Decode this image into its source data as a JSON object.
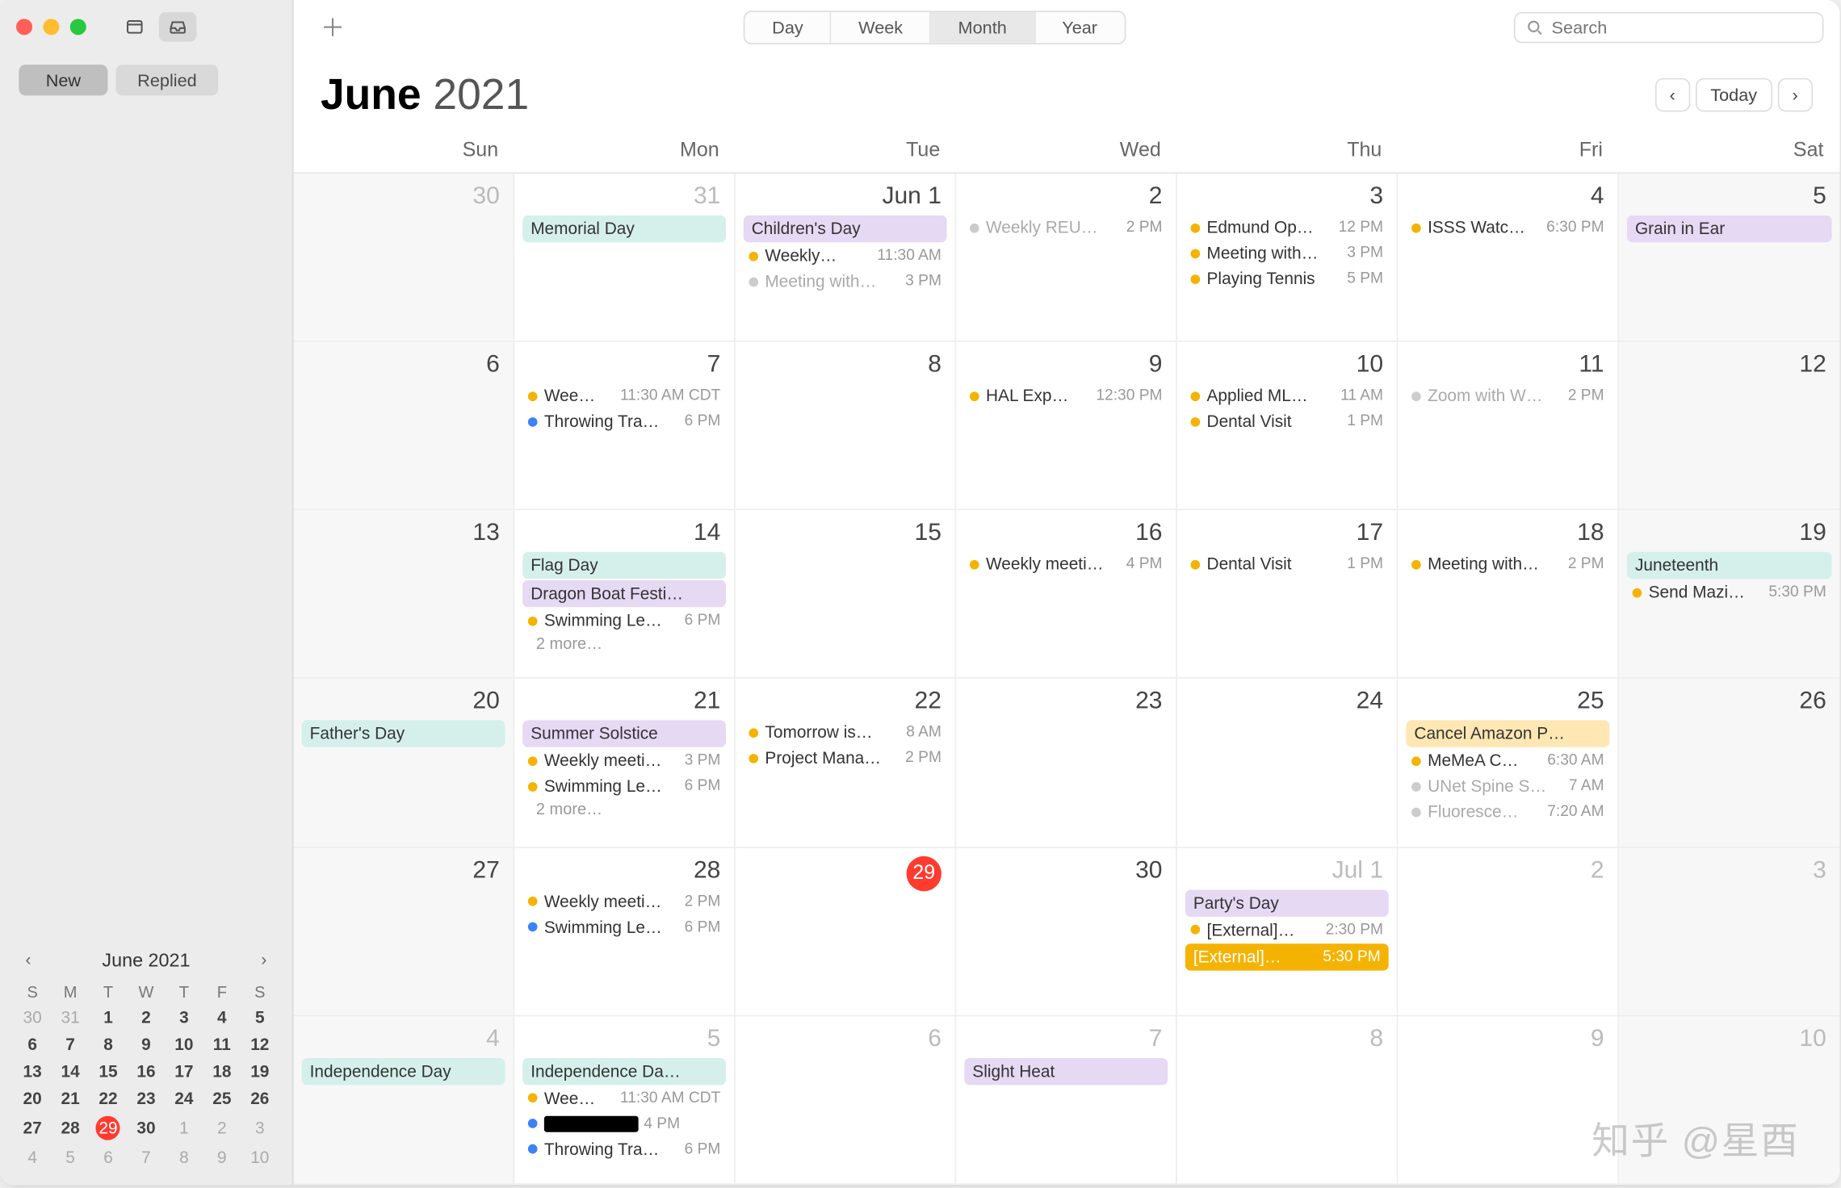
{
  "sidebar": {
    "filters": {
      "new": "New",
      "replied": "Replied"
    },
    "minical": {
      "title": "June 2021",
      "dow": [
        "S",
        "M",
        "T",
        "W",
        "T",
        "F",
        "S"
      ],
      "rows": [
        [
          {
            "n": "30",
            "dim": true
          },
          {
            "n": "31",
            "dim": true
          },
          {
            "n": "1",
            "bold": true
          },
          {
            "n": "2",
            "bold": true
          },
          {
            "n": "3",
            "bold": true
          },
          {
            "n": "4",
            "bold": true
          },
          {
            "n": "5",
            "bold": true
          }
        ],
        [
          {
            "n": "6",
            "bold": true
          },
          {
            "n": "7",
            "bold": true
          },
          {
            "n": "8",
            "bold": true
          },
          {
            "n": "9",
            "bold": true
          },
          {
            "n": "10",
            "bold": true
          },
          {
            "n": "11",
            "bold": true
          },
          {
            "n": "12",
            "bold": true
          }
        ],
        [
          {
            "n": "13",
            "bold": true
          },
          {
            "n": "14",
            "bold": true
          },
          {
            "n": "15",
            "bold": true
          },
          {
            "n": "16",
            "bold": true
          },
          {
            "n": "17",
            "bold": true
          },
          {
            "n": "18",
            "bold": true
          },
          {
            "n": "19",
            "bold": true
          }
        ],
        [
          {
            "n": "20",
            "bold": true
          },
          {
            "n": "21",
            "bold": true
          },
          {
            "n": "22",
            "bold": true
          },
          {
            "n": "23",
            "bold": true
          },
          {
            "n": "24",
            "bold": true
          },
          {
            "n": "25",
            "bold": true
          },
          {
            "n": "26",
            "bold": true
          }
        ],
        [
          {
            "n": "27",
            "bold": true
          },
          {
            "n": "28",
            "bold": true
          },
          {
            "n": "29",
            "today": true
          },
          {
            "n": "30",
            "bold": true
          },
          {
            "n": "1",
            "dim": true
          },
          {
            "n": "2",
            "dim": true
          },
          {
            "n": "3",
            "dim": true
          }
        ],
        [
          {
            "n": "4",
            "dim": true
          },
          {
            "n": "5",
            "dim": true
          },
          {
            "n": "6",
            "dim": true
          },
          {
            "n": "7",
            "dim": true
          },
          {
            "n": "8",
            "dim": true
          },
          {
            "n": "9",
            "dim": true
          },
          {
            "n": "10",
            "dim": true
          }
        ]
      ]
    }
  },
  "toolbar": {
    "views": [
      "Day",
      "Week",
      "Month",
      "Year"
    ],
    "active_view": "Month",
    "search_placeholder": "Search"
  },
  "header": {
    "month": "June",
    "year": "2021",
    "today": "Today"
  },
  "dow": [
    "Sun",
    "Mon",
    "Tue",
    "Wed",
    "Thu",
    "Fri",
    "Sat"
  ],
  "cells": [
    {
      "num": "30",
      "out": true,
      "wknd": true,
      "events": []
    },
    {
      "num": "31",
      "out": true,
      "events": [
        {
          "allday": true,
          "color": "teal",
          "title": "Memorial Day"
        }
      ]
    },
    {
      "num": "Jun 1",
      "events": [
        {
          "allday": true,
          "color": "violet",
          "title": "Children's Day"
        },
        {
          "dot": "yel",
          "title": "Weekly…",
          "time": "11:30 AM"
        },
        {
          "dot": "gray",
          "dim": true,
          "title": "Meeting with…",
          "time": "3 PM"
        }
      ]
    },
    {
      "num": "2",
      "events": [
        {
          "dot": "gray",
          "dim": true,
          "title": "Weekly REU…",
          "time": "2 PM"
        }
      ]
    },
    {
      "num": "3",
      "events": [
        {
          "dot": "yel",
          "title": "Edmund Op…",
          "time": "12 PM"
        },
        {
          "dot": "yel",
          "title": "Meeting with…",
          "time": "3 PM"
        },
        {
          "dot": "yel",
          "title": "Playing Tennis",
          "time": "5 PM"
        }
      ]
    },
    {
      "num": "4",
      "events": [
        {
          "dot": "yel",
          "title": "ISSS Watc…",
          "time": "6:30 PM"
        }
      ]
    },
    {
      "num": "5",
      "wknd": true,
      "events": [
        {
          "allday": true,
          "color": "violet",
          "title": "Grain in Ear"
        }
      ]
    },
    {
      "num": "6",
      "wknd": true,
      "events": []
    },
    {
      "num": "7",
      "events": [
        {
          "dot": "yel",
          "title": "Wee…",
          "time": "11:30 AM CDT"
        },
        {
          "dot": "blue",
          "title": "Throwing Tra…",
          "time": "6 PM"
        }
      ]
    },
    {
      "num": "8",
      "events": []
    },
    {
      "num": "9",
      "events": [
        {
          "dot": "yel",
          "title": "HAL Exp…",
          "time": "12:30 PM"
        }
      ]
    },
    {
      "num": "10",
      "events": [
        {
          "dot": "yel",
          "title": "Applied ML…",
          "time": "11 AM"
        },
        {
          "dot": "yel",
          "title": "Dental Visit",
          "time": "1 PM"
        }
      ]
    },
    {
      "num": "11",
      "events": [
        {
          "dot": "gray",
          "dim": true,
          "title": "Zoom with W…",
          "time": "2 PM"
        }
      ]
    },
    {
      "num": "12",
      "wknd": true,
      "events": []
    },
    {
      "num": "13",
      "wknd": true,
      "events": []
    },
    {
      "num": "14",
      "events": [
        {
          "allday": true,
          "color": "teal",
          "title": "Flag Day"
        },
        {
          "allday": true,
          "color": "violet",
          "title": "Dragon Boat Festi…"
        },
        {
          "dot": "yel",
          "title": "Swimming Le…",
          "time": "6 PM"
        }
      ],
      "more": "2 more…"
    },
    {
      "num": "15",
      "events": []
    },
    {
      "num": "16",
      "events": [
        {
          "dot": "yel",
          "title": "Weekly meeti…",
          "time": "4 PM"
        }
      ]
    },
    {
      "num": "17",
      "events": [
        {
          "dot": "yel",
          "title": "Dental Visit",
          "time": "1 PM"
        }
      ]
    },
    {
      "num": "18",
      "events": [
        {
          "dot": "yel",
          "title": "Meeting with…",
          "time": "2 PM"
        }
      ]
    },
    {
      "num": "19",
      "wknd": true,
      "events": [
        {
          "allday": true,
          "color": "teal",
          "title": "Juneteenth"
        },
        {
          "dot": "yel",
          "title": "Send Mazi…",
          "time": "5:30 PM"
        }
      ]
    },
    {
      "num": "20",
      "wknd": true,
      "events": [
        {
          "allday": true,
          "color": "teal",
          "title": "Father's Day"
        }
      ]
    },
    {
      "num": "21",
      "events": [
        {
          "allday": true,
          "color": "violet",
          "title": "Summer Solstice"
        },
        {
          "dot": "yel",
          "title": "Weekly meeti…",
          "time": "3 PM"
        },
        {
          "dot": "yel",
          "title": "Swimming Le…",
          "time": "6 PM"
        }
      ],
      "more": "2 more…"
    },
    {
      "num": "22",
      "events": [
        {
          "dot": "yel",
          "title": "Tomorrow is…",
          "time": "8 AM"
        },
        {
          "dot": "yel",
          "title": "Project Mana…",
          "time": "2 PM"
        }
      ]
    },
    {
      "num": "23",
      "events": []
    },
    {
      "num": "24",
      "events": []
    },
    {
      "num": "25",
      "events": [
        {
          "allday": true,
          "color": "amber",
          "title": "Cancel Amazon P…"
        },
        {
          "dot": "yel",
          "title": "MeMeA C…",
          "time": "6:30 AM"
        },
        {
          "dot": "gray",
          "dim": true,
          "title": "UNet Spine S…",
          "time": "7 AM"
        },
        {
          "dot": "gray",
          "dim": true,
          "title": "Fluoresce…",
          "time": "7:20 AM"
        }
      ]
    },
    {
      "num": "26",
      "wknd": true,
      "events": []
    },
    {
      "num": "27",
      "wknd": true,
      "events": []
    },
    {
      "num": "28",
      "events": [
        {
          "dot": "yel",
          "title": "Weekly meeti…",
          "time": "2 PM"
        },
        {
          "dot": "blue",
          "title": "Swimming Le…",
          "time": "6 PM"
        }
      ]
    },
    {
      "num": "29",
      "today": true,
      "events": []
    },
    {
      "num": "30",
      "events": []
    },
    {
      "num": "Jul 1",
      "out": true,
      "events": [
        {
          "allday": true,
          "color": "violet",
          "title": "Party's Day"
        },
        {
          "dot": "yel",
          "title": "[External]…",
          "time": "2:30 PM"
        },
        {
          "allday": true,
          "color": "amber-solid",
          "title": "[External]…",
          "time": "5:30 PM",
          "whitetext": true
        }
      ]
    },
    {
      "num": "2",
      "out": true,
      "events": []
    },
    {
      "num": "3",
      "out": true,
      "wknd": true,
      "events": []
    },
    {
      "num": "4",
      "out": true,
      "wknd": true,
      "events": [
        {
          "allday": true,
          "color": "teal",
          "title": "Independence Day"
        }
      ]
    },
    {
      "num": "5",
      "out": true,
      "events": [
        {
          "allday": true,
          "color": "teal",
          "title": "Independence Da…"
        },
        {
          "dot": "yel",
          "title": "Wee…",
          "time": "11:30 AM CDT"
        },
        {
          "dot": "blue",
          "title": "██████",
          "time": "4 PM",
          "redact": true
        },
        {
          "dot": "blue",
          "title": "Throwing Tra…",
          "time": "6 PM"
        }
      ]
    },
    {
      "num": "6",
      "out": true,
      "events": []
    },
    {
      "num": "7",
      "out": true,
      "events": [
        {
          "allday": true,
          "color": "violet",
          "title": "Slight Heat"
        }
      ]
    },
    {
      "num": "8",
      "out": true,
      "events": []
    },
    {
      "num": "9",
      "out": true,
      "events": []
    },
    {
      "num": "10",
      "out": true,
      "wknd": true,
      "events": []
    }
  ],
  "watermark": "知乎 @星酉"
}
